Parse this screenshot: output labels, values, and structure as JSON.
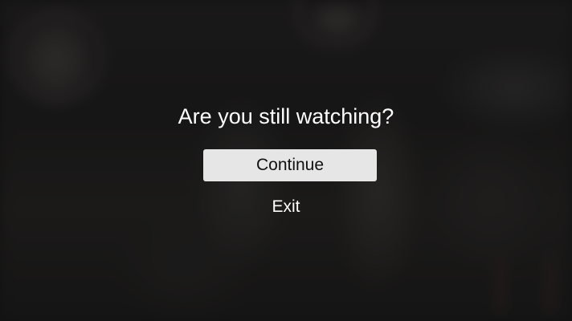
{
  "dialog": {
    "title": "Are you still watching?",
    "continue_label": "Continue",
    "exit_label": "Exit"
  },
  "colors": {
    "overlay_text": "#ffffff",
    "primary_button_bg": "#e6e6e6",
    "primary_button_text": "#111111",
    "backdrop": "#1e1e1e"
  }
}
